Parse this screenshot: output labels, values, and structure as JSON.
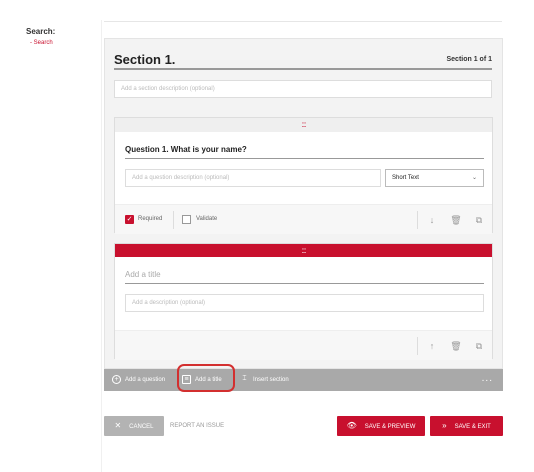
{
  "sidebar": {
    "title": "Search:",
    "link": "- Search"
  },
  "section": {
    "title": "Section 1.",
    "count": "Section 1 of 1",
    "description_placeholder": "Add a section description (optional)"
  },
  "question": {
    "handle": ":::",
    "title": "Question 1. What is your name?",
    "description_placeholder": "Add a question description (optional)",
    "type_value": "Short Text",
    "required_label": "Required",
    "required_checked": true,
    "validate_label": "Validate",
    "validate_checked": false
  },
  "title_block": {
    "handle": ":::",
    "title_placeholder": "Add a title",
    "description_placeholder": "Add a description (optional)"
  },
  "toolbar": {
    "add_question": "Add a question",
    "add_title": "Add a title",
    "insert_section": "Insert section",
    "more": "..."
  },
  "footer": {
    "cancel": "CANCEL",
    "report": "REPORT AN ISSUE",
    "save_preview": "SAVE & PREVIEW",
    "save_exit": "SAVE & EXIT"
  },
  "colors": {
    "accent": "#c8102e",
    "toolbar": "#a9a9a9",
    "highlight": "#d32f2f"
  },
  "icons": [
    "plus-circle-icon",
    "title-icon",
    "insert-section-icon",
    "more-icon",
    "arrow-down-icon",
    "arrow-up-icon",
    "trash-icon",
    "copy-icon",
    "eye-icon",
    "chevrons-right-icon",
    "close-icon",
    "chevron-down-icon",
    "checkmark-icon",
    "drag-handle-icon"
  ]
}
